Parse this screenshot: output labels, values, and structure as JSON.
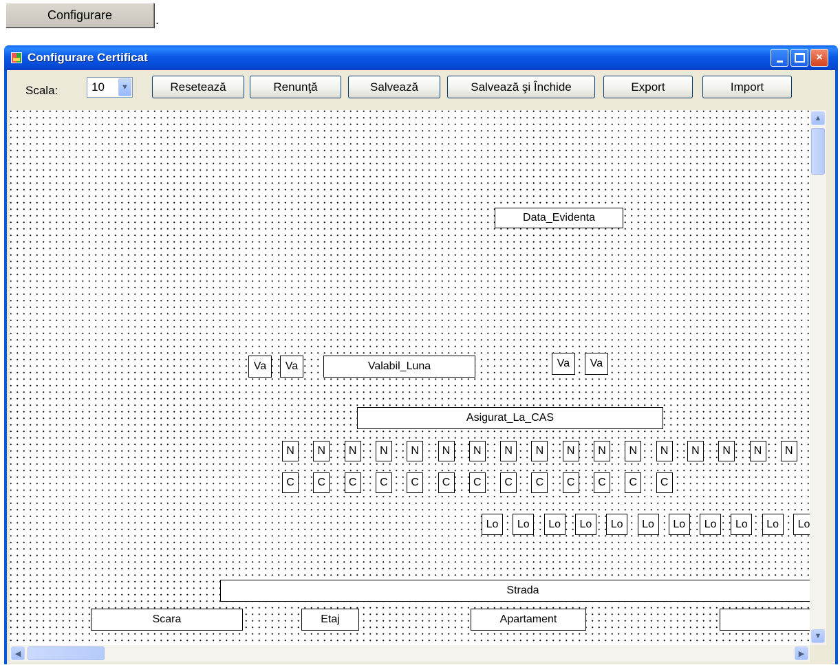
{
  "top": {
    "button_label": "Configurare",
    "trailing": "."
  },
  "window": {
    "title": "Configurare Certificat",
    "controls": {
      "minimize": "minimize",
      "maximize": "maximize",
      "close": "×"
    }
  },
  "toolbar": {
    "scale_label": "Scala:",
    "scale_value": "10",
    "buttons": {
      "reset": "Resetează",
      "cancel": "Renunţă",
      "save": "Salvează",
      "save_close": "Salvează şi Închide",
      "export": "Export",
      "import": "Import"
    }
  },
  "fields": {
    "data_evidenta": "Data_Evidenta",
    "va": "Va",
    "valabil_luna": "Valabil_Luna",
    "asigurat_la_cas": "Asigurat_La_CAS",
    "n": "N",
    "c": "C",
    "lo": "Lo",
    "strada": "Strada",
    "scara": "Scara",
    "etaj": "Etaj",
    "apartament": "Apartament",
    "blank": ""
  },
  "scrollbars": {
    "up_icon": "arrow-up-icon",
    "down_icon": "arrow-down-icon",
    "left_icon": "arrow-left-icon",
    "right_icon": "arrow-right-icon"
  }
}
